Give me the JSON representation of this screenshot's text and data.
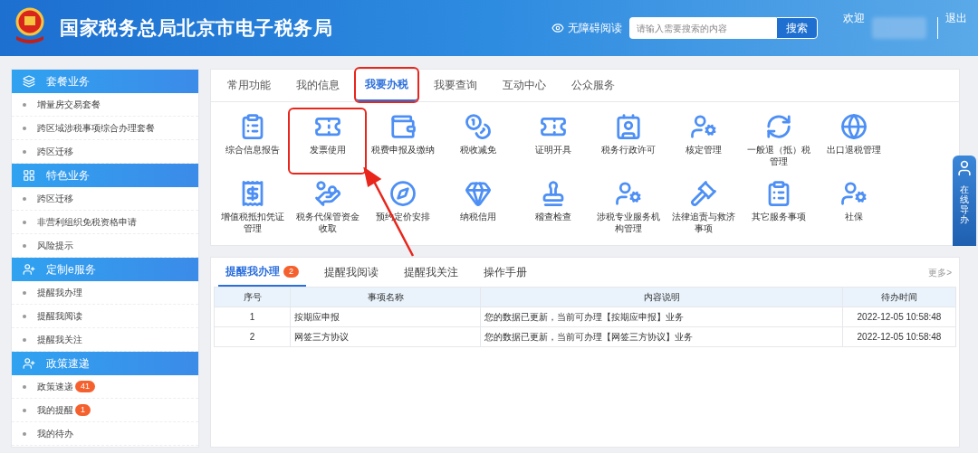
{
  "header": {
    "title": "国家税务总局北京市电子税务局",
    "accessibility": "无障碍阅读",
    "search": {
      "placeholder": "请输入需要搜索的内容",
      "button": "搜索"
    },
    "welcome": "欢迎",
    "logout": "退出"
  },
  "sidebar": [
    {
      "title": "套餐业务",
      "items": [
        {
          "label": "增量房交易套餐"
        },
        {
          "label": "跨区域涉税事项综合办理套餐"
        },
        {
          "label": "跨区迁移"
        }
      ]
    },
    {
      "title": "特色业务",
      "items": [
        {
          "label": "跨区迁移"
        },
        {
          "label": "非营利组织免税资格申请"
        },
        {
          "label": "风险提示"
        }
      ]
    },
    {
      "title": "定制e服务",
      "items": [
        {
          "label": "提醒我办理"
        },
        {
          "label": "提醒我阅读"
        },
        {
          "label": "提醒我关注"
        }
      ]
    },
    {
      "title": "政策速递",
      "items": [
        {
          "label": "政策速递",
          "badge": "41"
        },
        {
          "label": "我的提醒",
          "badge": "1"
        },
        {
          "label": "我的待办"
        }
      ]
    }
  ],
  "tabs": [
    {
      "label": "常用功能",
      "selected": false,
      "annotated": false
    },
    {
      "label": "我的信息",
      "selected": false,
      "annotated": false
    },
    {
      "label": "我要办税",
      "selected": true,
      "annotated": true
    },
    {
      "label": "我要查询",
      "selected": false,
      "annotated": false
    },
    {
      "label": "互动中心",
      "selected": false,
      "annotated": false
    },
    {
      "label": "公众服务",
      "selected": false,
      "annotated": false
    }
  ],
  "functions": [
    {
      "label": "综合信息报告",
      "annotated": false
    },
    {
      "label": "发票使用",
      "annotated": true
    },
    {
      "label": "税费申报及缴纳",
      "annotated": false
    },
    {
      "label": "税收减免",
      "annotated": false
    },
    {
      "label": "证明开具",
      "annotated": false
    },
    {
      "label": "税务行政许可",
      "annotated": false
    },
    {
      "label": "核定管理",
      "annotated": false
    },
    {
      "label": "一般退（抵）税管理",
      "annotated": false
    },
    {
      "label": "出口退税管理",
      "annotated": false
    },
    {
      "label": "增值税抵扣凭证管理",
      "annotated": false
    },
    {
      "label": "税务代保管资金收取",
      "annotated": false
    },
    {
      "label": "预约定价安排",
      "annotated": false
    },
    {
      "label": "纳税信用",
      "annotated": false
    },
    {
      "label": "稽查检查",
      "annotated": false
    },
    {
      "label": "涉税专业服务机构管理",
      "annotated": false
    },
    {
      "label": "法律追责与救济事项",
      "annotated": false
    },
    {
      "label": "其它服务事项",
      "annotated": false
    },
    {
      "label": "社保",
      "annotated": false
    }
  ],
  "guide": "在线导办",
  "reminders": {
    "tabs": [
      {
        "label": "提醒我办理",
        "badge": "2",
        "selected": true
      },
      {
        "label": "提醒我阅读",
        "selected": false
      },
      {
        "label": "提醒我关注",
        "selected": false
      },
      {
        "label": "操作手册",
        "selected": false
      }
    ],
    "more": "更多>",
    "table": {
      "columns": [
        "序号",
        "事项名称",
        "内容说明",
        "待办时间"
      ],
      "rows": [
        [
          "1",
          "按期应申报",
          "您的数据已更新，当前可办理【按期应申报】业务",
          "2022-12-05 10:58:48"
        ],
        [
          "2",
          "网签三方协议",
          "您的数据已更新，当前可办理【网签三方协议】业务",
          "2022-12-05 10:58:48"
        ]
      ]
    }
  }
}
